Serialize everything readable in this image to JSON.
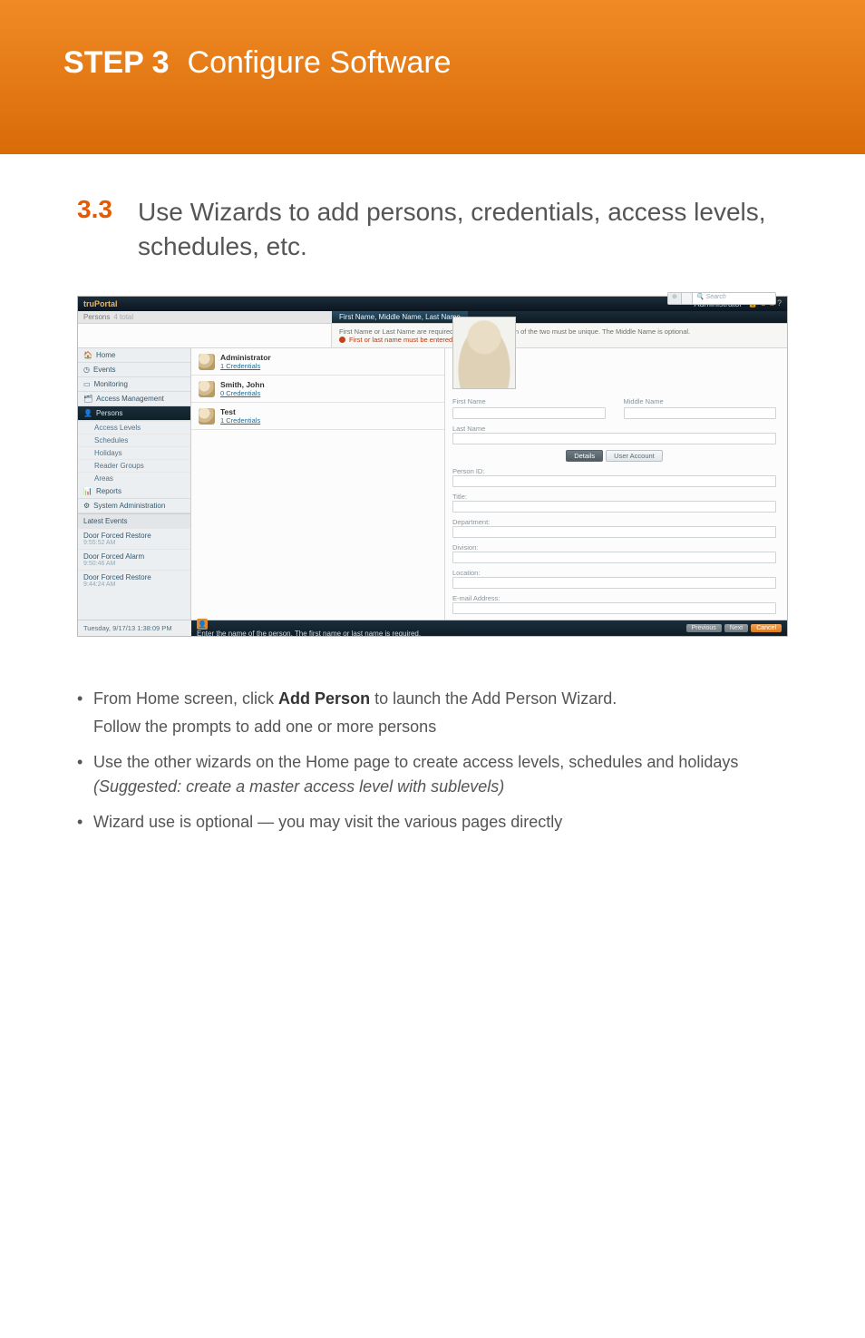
{
  "banner": {
    "step": "STEP 3",
    "title": "Configure Software"
  },
  "section": {
    "num": "3.3",
    "text": "Use Wizards to add persons, credentials, access levels, schedules, etc."
  },
  "app": {
    "logo": "truPortal",
    "header_right_role": "Administrator",
    "wiz_step_label": "First Name, Middle Name, Last Name",
    "wiz_note_1": "First Name or Last Name are required, and the combination of the two must be unique. The Middle Name is optional.",
    "wiz_note_2": "First or last name must be entered.",
    "persons_header": "Persons",
    "persons_count": "4 total",
    "search_placeholder": "Search",
    "sidebar": {
      "items": [
        "Home",
        "Events",
        "Monitoring",
        "Access Management"
      ],
      "active": "Persons",
      "subs": [
        "Access Levels",
        "Schedules",
        "Holidays",
        "Reader Groups",
        "Areas"
      ],
      "tail": [
        "Reports",
        "System Administration"
      ],
      "sec_label": "Latest Events",
      "events": [
        {
          "t": "Door Forced Restore",
          "ts": "9:55:52 AM"
        },
        {
          "t": "Door Forced Alarm",
          "ts": "9:50:46 AM"
        },
        {
          "t": "Door Forced Restore",
          "ts": "9:44:24 AM"
        }
      ]
    },
    "persons": [
      {
        "name": "Administrator",
        "cred": "1 Credentials"
      },
      {
        "name": "Smith, John",
        "cred": "0 Credentials"
      },
      {
        "name": "Test",
        "cred": "1 Credentials"
      }
    ],
    "form": {
      "first": "First Name",
      "middle": "Middle Name",
      "last": "Last Name",
      "tabs": {
        "a": "Details",
        "b": "User Account"
      },
      "fields": [
        "Person ID:",
        "Title:",
        "Department:",
        "Division:",
        "Location:",
        "E-mail Address:"
      ]
    },
    "footer": {
      "ts": "Tuesday, 9/17/13 1:38:09 PM",
      "hint": "Enter the name of the person. The first name or last name is required.",
      "btns": {
        "p": "Previous",
        "n": "Next",
        "c": "Cancel"
      }
    }
  },
  "bullets": {
    "a_1": "From Home screen, click ",
    "a_bold": "Add Person",
    "a_2": " to launch the Add Person Wizard.",
    "a_sub": "Follow the prompts to add one or more persons",
    "b_1": "Use the other wizards on the Home page to create access levels, schedules and holidays ",
    "b_em": "(Suggested: create a master access level with sublevels)",
    "c": "Wizard use is optional — you may visit the various pages directly"
  }
}
